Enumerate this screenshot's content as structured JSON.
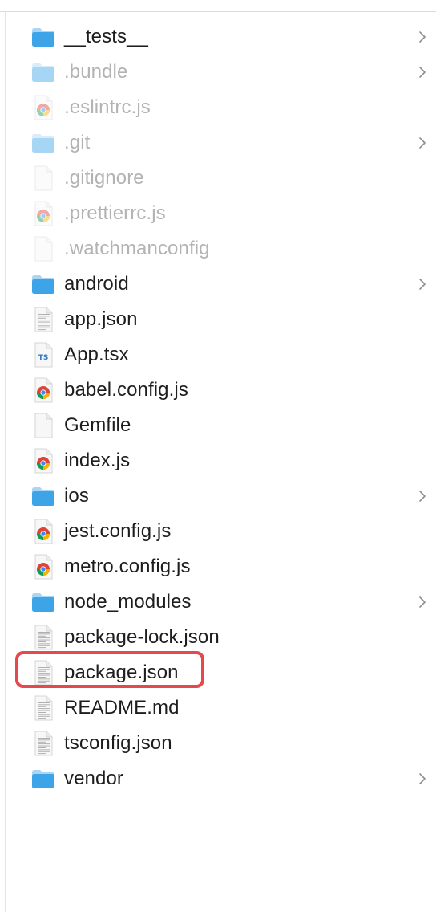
{
  "colors": {
    "folder": "#3ea4e8",
    "folder_light": "#a9d6f5",
    "highlight": "#e5484d",
    "text": "#1d1d1f",
    "text_hidden": "#b3b3b3"
  },
  "files": [
    {
      "name": "__tests__",
      "kind": "folder",
      "icon": "folder-icon",
      "hidden": false,
      "chevron": true
    },
    {
      "name": ".bundle",
      "kind": "folder",
      "icon": "folder-icon",
      "hidden": true,
      "chevron": true
    },
    {
      "name": ".eslintrc.js",
      "kind": "js",
      "icon": "chrome-js-icon",
      "hidden": true,
      "chevron": false
    },
    {
      "name": ".git",
      "kind": "folder",
      "icon": "folder-icon",
      "hidden": true,
      "chevron": true
    },
    {
      "name": ".gitignore",
      "kind": "blank",
      "icon": "blank-file-icon",
      "hidden": true,
      "chevron": false
    },
    {
      "name": ".prettierrc.js",
      "kind": "js",
      "icon": "chrome-js-icon",
      "hidden": true,
      "chevron": false
    },
    {
      "name": ".watchmanconfig",
      "kind": "blank",
      "icon": "blank-file-icon",
      "hidden": true,
      "chevron": false
    },
    {
      "name": "android",
      "kind": "folder",
      "icon": "folder-icon",
      "hidden": false,
      "chevron": true
    },
    {
      "name": "app.json",
      "kind": "doc",
      "icon": "text-document-icon",
      "hidden": false,
      "chevron": false
    },
    {
      "name": "App.tsx",
      "kind": "ts",
      "icon": "typescript-file-icon",
      "hidden": false,
      "chevron": false,
      "badge": "TS"
    },
    {
      "name": "babel.config.js",
      "kind": "js",
      "icon": "chrome-js-icon",
      "hidden": false,
      "chevron": false
    },
    {
      "name": "Gemfile",
      "kind": "blank",
      "icon": "blank-file-icon",
      "hidden": false,
      "chevron": false
    },
    {
      "name": "index.js",
      "kind": "js",
      "icon": "chrome-js-icon",
      "hidden": false,
      "chevron": false
    },
    {
      "name": "ios",
      "kind": "folder",
      "icon": "folder-icon",
      "hidden": false,
      "chevron": true
    },
    {
      "name": "jest.config.js",
      "kind": "js",
      "icon": "chrome-js-icon",
      "hidden": false,
      "chevron": false
    },
    {
      "name": "metro.config.js",
      "kind": "js",
      "icon": "chrome-js-icon",
      "hidden": false,
      "chevron": false
    },
    {
      "name": "node_modules",
      "kind": "folder",
      "icon": "folder-icon",
      "hidden": false,
      "chevron": true
    },
    {
      "name": "package-lock.json",
      "kind": "doc",
      "icon": "text-document-icon",
      "hidden": false,
      "chevron": false
    },
    {
      "name": "package.json",
      "kind": "doc",
      "icon": "text-document-icon",
      "hidden": false,
      "chevron": false,
      "highlighted": true
    },
    {
      "name": "README.md",
      "kind": "doc",
      "icon": "text-document-icon",
      "hidden": false,
      "chevron": false
    },
    {
      "name": "tsconfig.json",
      "kind": "doc",
      "icon": "text-document-icon",
      "hidden": false,
      "chevron": false
    },
    {
      "name": "vendor",
      "kind": "folder",
      "icon": "folder-icon",
      "hidden": false,
      "chevron": true
    }
  ]
}
